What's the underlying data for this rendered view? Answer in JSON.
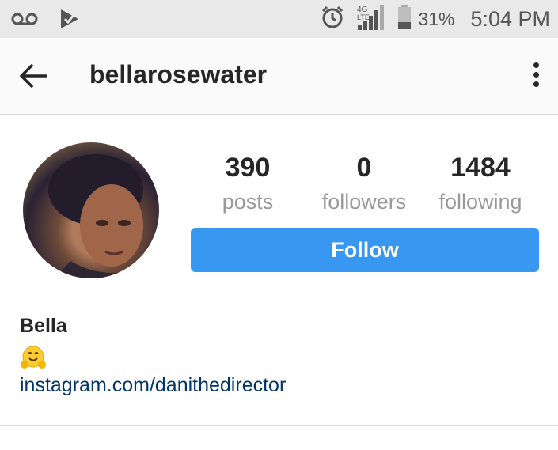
{
  "status_bar": {
    "icons": [
      "voicemail-icon",
      "notification-check-icon",
      "alarm-icon",
      "signal-4g-lte-icon",
      "battery-icon"
    ],
    "network": "4G LTE",
    "battery": "31%",
    "time": "5:04 PM"
  },
  "header": {
    "username": "bellarosewater"
  },
  "profile": {
    "stats": [
      {
        "value": "390",
        "label": "posts"
      },
      {
        "value": "0",
        "label": "followers"
      },
      {
        "value": "1484",
        "label": "following"
      }
    ],
    "follow_label": "Follow",
    "name": "Bella",
    "bio_emoji": "hugging-face-emoji",
    "link": "instagram.com/danithedirector"
  },
  "colors": {
    "accent": "#3897f0",
    "link": "#003569",
    "status_bar_bg": "#e9e9e9"
  }
}
